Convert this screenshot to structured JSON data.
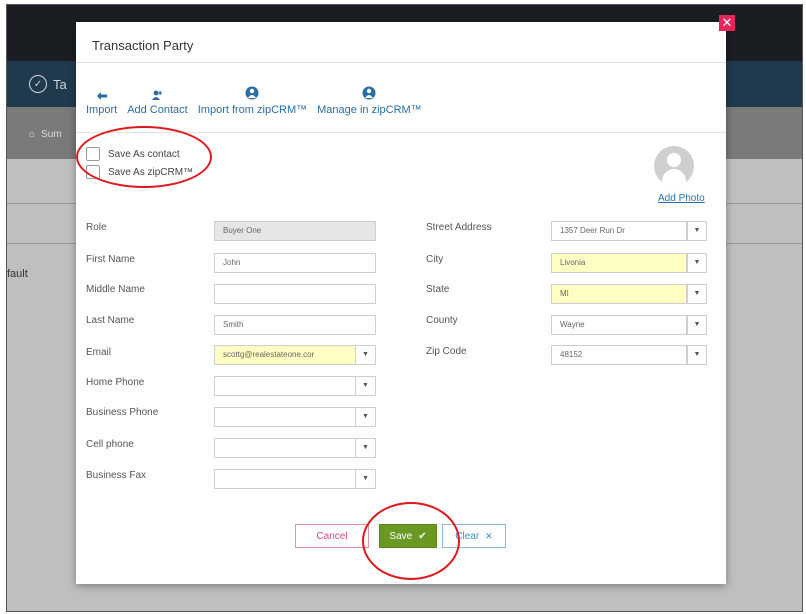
{
  "background": {
    "nav_item": "Ta",
    "crumb": "Sum",
    "row_text": "fault"
  },
  "modal": {
    "title": "Transaction Party",
    "close_glyph": "✕",
    "toolbar": [
      {
        "label": "Import",
        "icon": "import-icon",
        "glyph": "⬅"
      },
      {
        "label": "Add Contact",
        "icon": "add-contact-icon",
        "glyph": "👤"
      },
      {
        "label": "Import from zipCRM™",
        "icon": "zipcrm-icon",
        "glyph": "●"
      },
      {
        "label": "Manage in zipCRM™",
        "icon": "zipcrm-icon",
        "glyph": "●"
      }
    ],
    "checkboxes": {
      "save_as_contact": "Save As contact",
      "save_as_zipcrm": "Save As zipCRM™"
    },
    "add_photo": "Add Photo",
    "left_form": {
      "role": {
        "label": "Role",
        "value": "Buyer One"
      },
      "first_name": {
        "label": "First Name",
        "value": "John"
      },
      "middle_name": {
        "label": "Middle Name",
        "value": ""
      },
      "last_name": {
        "label": "Last Name",
        "value": "Smith"
      },
      "email": {
        "label": "Email",
        "value": "scottg@realestateone.cor"
      },
      "home_phone": {
        "label": "Home Phone",
        "value": ""
      },
      "business_phone": {
        "label": "Business Phone",
        "value": ""
      },
      "cell_phone": {
        "label": "Cell phone",
        "value": ""
      },
      "business_fax": {
        "label": "Business Fax",
        "value": ""
      }
    },
    "right_form": {
      "street": {
        "label": "Street Address",
        "value": "1357 Deer Run Dr"
      },
      "city": {
        "label": "City",
        "value": "Livonia"
      },
      "state": {
        "label": "State",
        "value": "MI"
      },
      "county": {
        "label": "County",
        "value": "Wayne"
      },
      "zip": {
        "label": "Zip Code",
        "value": "48152"
      }
    },
    "buttons": {
      "cancel": "Cancel",
      "save": "Save",
      "save_glyph": "✔",
      "clear": "Clear",
      "clear_glyph": "✕"
    }
  },
  "colors": {
    "accent_blue": "#2a6ea6",
    "save_green": "#6a9923",
    "highlight_yellow": "#ffffc4",
    "annotation_red": "#e2171c",
    "close_pink": "#e8245b"
  }
}
